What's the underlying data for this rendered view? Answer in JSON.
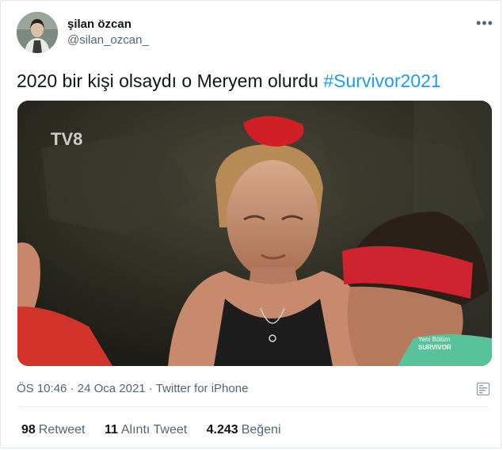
{
  "user": {
    "name": "şilan özcan",
    "handle": "@silan_ozcan_"
  },
  "more_icon": "more-dots-icon",
  "tweet": {
    "text": "2020 bir kişi olsaydı o Meryem olurdu ",
    "hashtag": "#Survivor2021"
  },
  "media": {
    "watermark": "TV8",
    "caption_line1": "Yeni Bölüm",
    "caption_line2": "SURVIVOR"
  },
  "meta": {
    "time": "ÖS 10:46",
    "sep1": " · ",
    "date": "24 Oca 2021",
    "sep2": " · ",
    "source": "Twitter for iPhone"
  },
  "stats": {
    "retweets_count": "98",
    "retweets_label": "Retweet",
    "quotes_count": "11",
    "quotes_label": "Alıntı Tweet",
    "likes_count": "4.243",
    "likes_label": "Beğeni"
  },
  "colors": {
    "link": "#1d9bf0",
    "secondary_text": "#536471",
    "text": "#0f1419"
  }
}
